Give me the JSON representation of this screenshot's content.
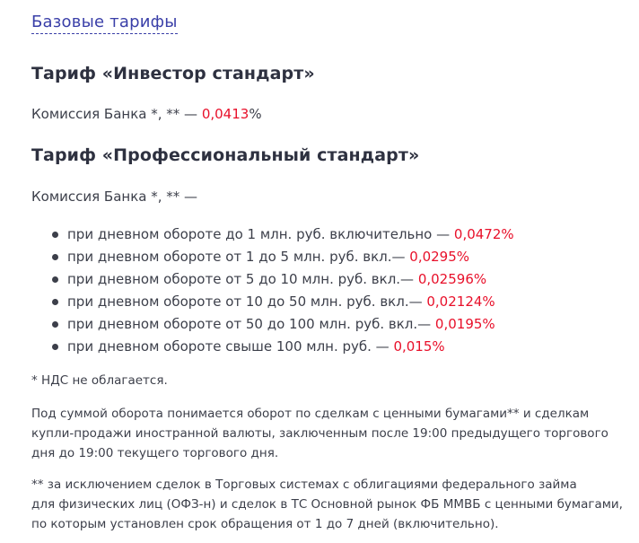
{
  "top_link": "Базовые тарифы",
  "tariff_investor": {
    "title": "Тариф «Инвестор стандарт»",
    "commission_label": "Комиссия Банка",
    "commission_marks": " *, ** — ",
    "rate": "0,0413",
    "rate_suffix": "%"
  },
  "tariff_professional": {
    "title": "Тариф «Профессиональный стандарт»",
    "commission_label": "Комиссия Банка",
    "commission_marks": " *, ** —",
    "items": [
      {
        "text": "при дневном обороте до 1 млн. руб. включительно — ",
        "rate": "0,0472%"
      },
      {
        "text": "при дневном обороте от 1 до 5 млн. руб. вкл.— ",
        "rate": "0,0295%"
      },
      {
        "text": "при дневном обороте от 5 до 10 млн. руб. вкл.— ",
        "rate": "0,02596%"
      },
      {
        "text": "при дневном обороте от 10 до 50 млн. руб. вкл.— ",
        "rate": "0,02124%"
      },
      {
        "text": "при дневном обороте от 50 до 100 млн. руб. вкл.— ",
        "rate": "0,0195%"
      },
      {
        "text": "при дневном обороте свыше 100 млн. руб. — ",
        "rate": "0,015%"
      }
    ]
  },
  "notes": {
    "vat": "* НДС не облагается.",
    "turnover": "Под суммой оборота понимается оборот по сделкам с ценными бумагами** и сделкам купли-продажи иностранной валюты, заключенным после 19:00 предыдущего торгового дня до 19:00 текущего торгового дня.",
    "exclusion_line1": "**  за исключением сделок в Торговых системах с облигациями федерального займа",
    "exclusion_line2": "для физических лиц (ОФЗ-н) и сделок в ТС Основной рынок ФБ ММВБ с ценными бумагами,",
    "exclusion_line3": "по которым установлен срок обращения от 1 до 7 дней (включительно)."
  },
  "colors": {
    "accent_red": "#e8102a",
    "link_blue": "#3a3fa8",
    "text": "#3c3f4a"
  }
}
